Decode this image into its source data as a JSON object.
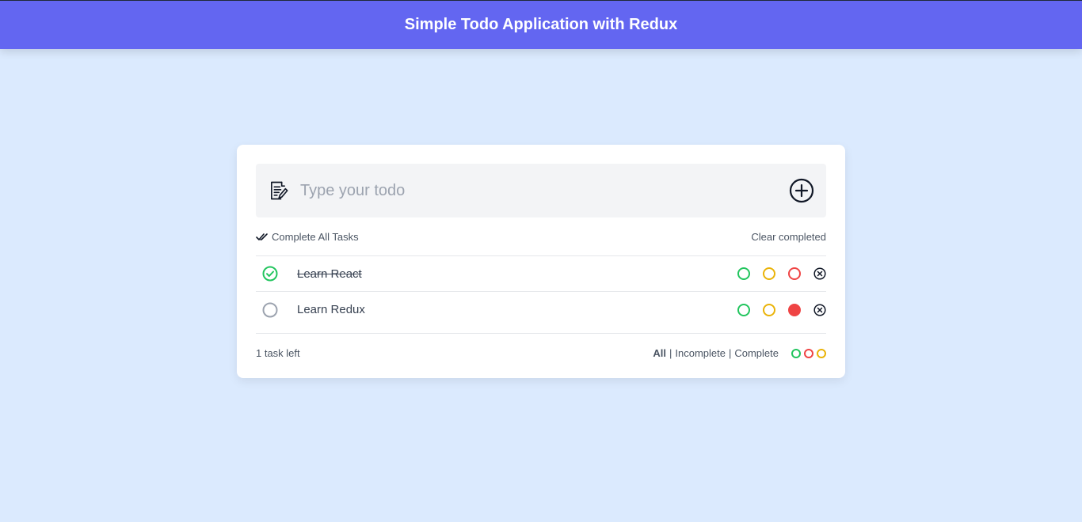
{
  "header": {
    "title": "Simple Todo Application with Redux"
  },
  "input": {
    "placeholder": "Type your todo",
    "value": ""
  },
  "actions": {
    "complete_all_label": "Complete All Tasks",
    "clear_completed_label": "Clear completed"
  },
  "todos": [
    {
      "text": "Learn React",
      "completed": true,
      "color": ""
    },
    {
      "text": "Learn Redux",
      "completed": false,
      "color": "red"
    }
  ],
  "priority_colors": {
    "green": "#22c55e",
    "yellow": "#eab308",
    "red": "#ef4444"
  },
  "footer": {
    "tasks_left": "1 task left",
    "filter_all": "All",
    "filter_incomplete": "Incomplete",
    "filter_complete": "Complete",
    "separator": "|"
  },
  "colors": {
    "accent": "#6366f1",
    "background": "#dbeafe"
  }
}
